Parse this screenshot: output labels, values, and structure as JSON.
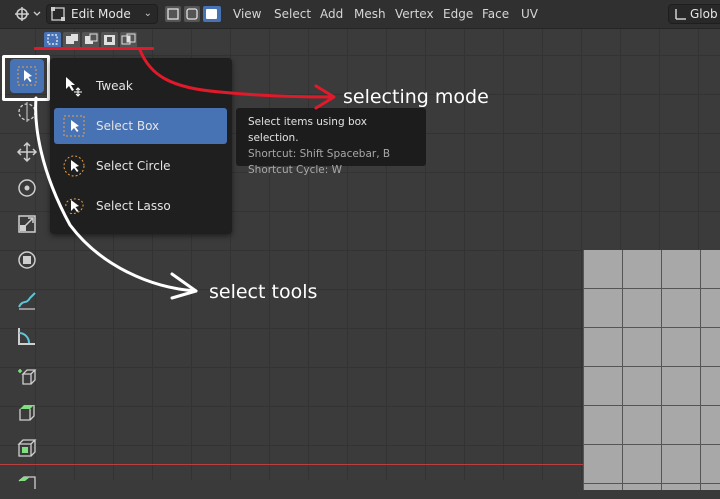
{
  "header": {
    "mode_select": "Edit Mode",
    "menu": [
      "View",
      "Select",
      "Add",
      "Mesh",
      "Vertex",
      "Edge",
      "Face",
      "UV"
    ],
    "orientation": "Glob"
  },
  "select_modes": [
    "vertex-select",
    "edge-select",
    "face-select"
  ],
  "tool_popup": {
    "items": [
      {
        "label": "Tweak",
        "icon": "tweak-icon"
      },
      {
        "label": "Select Box",
        "icon": "select-box-icon",
        "active": true
      },
      {
        "label": "Select Circle",
        "icon": "select-circle-icon"
      },
      {
        "label": "Select Lasso",
        "icon": "select-lasso-icon"
      }
    ]
  },
  "tooltip": {
    "line1": "Select items using box selection.",
    "line2": "Shortcut: Shift Spacebar, B",
    "line3": "Shortcut Cycle: W"
  },
  "annotations": {
    "selecting_mode": "selecting mode",
    "select_tools": "select tools"
  },
  "colors": {
    "accent": "#4772b3",
    "annotation_red": "#e01a2a",
    "annotation_white": "#ffffff"
  }
}
